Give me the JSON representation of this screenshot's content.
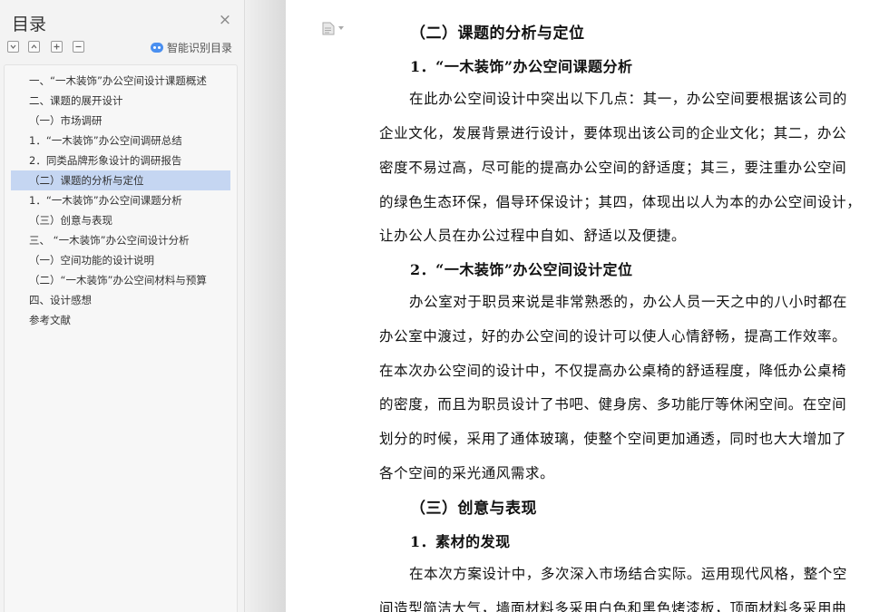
{
  "toc": {
    "title": "目录",
    "smart_label": "智能识别目录",
    "tools": [
      "expand-all",
      "collapse-all",
      "add-level",
      "remove-level"
    ],
    "items": [
      {
        "label": "一、“一木装饰”办公空间设计课题概述",
        "selected": false
      },
      {
        "label": "二、课题的展开设计",
        "selected": false
      },
      {
        "label": "（一）市场调研",
        "selected": false
      },
      {
        "label": "1．“一木装饰”办公空间调研总结",
        "selected": false
      },
      {
        "label": "2．同类品牌形象设计的调研报告",
        "selected": false
      },
      {
        "label": "（二）课题的分析与定位",
        "selected": true
      },
      {
        "label": "1．“一木装饰”办公空间课题分析",
        "selected": false
      },
      {
        "label": "（三）创意与表现",
        "selected": false
      },
      {
        "label": "三、 “一木装饰”办公空间设计分析",
        "selected": false
      },
      {
        "label": "（一）空间功能的设计说明",
        "selected": false
      },
      {
        "label": "（二）“一木装饰”办公空间材料与预算",
        "selected": false
      },
      {
        "label": "四、设计感想",
        "selected": false
      },
      {
        "label": "参考文献",
        "selected": false
      }
    ]
  },
  "document": {
    "heading_analysis": "（二）课题的分析与定位",
    "sub_analysis": "1．“一木装饰”办公空间课题分析",
    "para1": [
      "在此办公空间设计中突出以下几点：其一，办公空间要根据该公司的",
      "企业文化，发展背景进行设计，要体现出该公司的企业文化；其二，办公",
      "密度不易过高，尽可能的提高办公空间的舒适度；其三，要注重办公空间",
      "的绿色生态环保，倡导环保设计；其四，体现出以人为本的办公空间设计，",
      "让办公人员在办公过程中自如、舒适以及便捷。"
    ],
    "sub_position": "2．“一木装饰”办公空间设计定位",
    "para2": [
      "办公室对于职员来说是非常熟悉的，办公人员一天之中的八小时都在",
      "办公室中渡过，好的办公空间的设计可以使人心情舒畅，提高工作效率。",
      "在本次办公空间的设计中，不仅提高办公桌椅的舒适程度，降低办公桌椅",
      "的密度，而且为职员设计了书吧、健身房、多功能厅等休闲空间。在空间",
      "划分的时候，采用了通体玻璃，使整个空间更加通透，同时也大大增加了",
      "各个空间的采光通风需求。"
    ],
    "heading_creative": "（三）创意与表现",
    "sub_material": "1．素材的发现",
    "para3": [
      "在本次方案设计中，多次深入市场结合实际。运用现代风格，整个空",
      "间造型简洁大气，墙面材料多采用白色和黑色烤漆板，顶面材料多采用曲"
    ]
  },
  "colors": {
    "selected_bg": "#c5d6f2",
    "panel_bg": "#f3f3f3",
    "accent": "#4a8ff0"
  }
}
